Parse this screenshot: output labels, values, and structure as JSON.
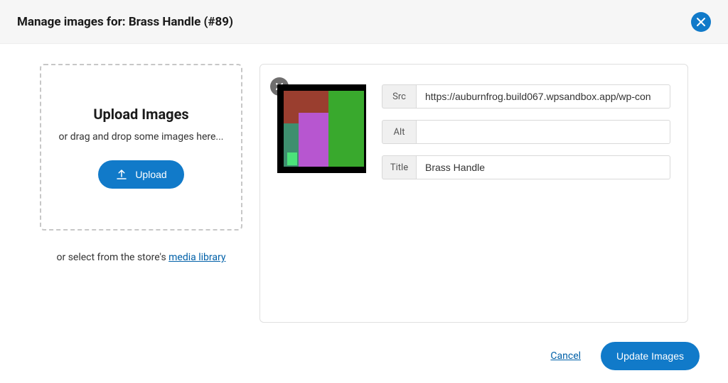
{
  "header": {
    "title": "Manage images for: Brass Handle (#89)"
  },
  "upload": {
    "heading": "Upload Images",
    "subtext": "or drag and drop some images here...",
    "button_label": "Upload",
    "media_lib_prefix": "or select from the store's ",
    "media_lib_link": "media library"
  },
  "image_fields": {
    "src_label": "Src",
    "src_value": "https://auburnfrog.build067.wpsandbox.app/wp-con",
    "alt_label": "Alt",
    "alt_value": "",
    "title_label": "Title",
    "title_value": "Brass Handle"
  },
  "footer": {
    "cancel_label": "Cancel",
    "update_label": "Update Images"
  }
}
